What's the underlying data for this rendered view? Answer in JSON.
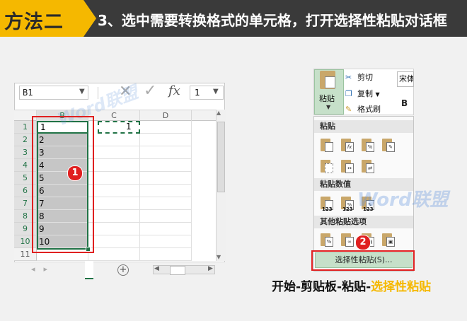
{
  "header": {
    "method": "方法二",
    "step": "3、选中需要转换格式的单元格，打开选择性粘贴对话框"
  },
  "formula_bar": {
    "name_box": "B1",
    "fx": "fx",
    "value": "1"
  },
  "sheet": {
    "columns": [
      "B",
      "C",
      "D"
    ],
    "rows": [
      "1",
      "2",
      "3",
      "4",
      "5",
      "6",
      "7",
      "8",
      "9",
      "10",
      "11"
    ],
    "b_values": [
      "1",
      "2",
      "3",
      "4",
      "5",
      "6",
      "7",
      "8",
      "9",
      "10"
    ],
    "c1_value": "1"
  },
  "badges": {
    "one": "1",
    "two": "2"
  },
  "ribbon": {
    "paste": "粘贴",
    "cut": "剪切",
    "copy": "复制",
    "format_painter": "格式刷",
    "font": "宋体",
    "bold": "B"
  },
  "paste_menu": {
    "section_paste": "粘贴",
    "section_values": "粘贴数值",
    "section_other": "其他粘贴选项",
    "paste_special": "选择性粘贴(S)...",
    "value_marks": [
      "123",
      "123",
      "123"
    ]
  },
  "watermark": "Word联盟",
  "path": {
    "prefix": "开始-剪贴板-粘贴-",
    "highlight": "选择性粘贴"
  },
  "colors": {
    "accent": "#f5b800",
    "excel_green": "#217346",
    "callout_red": "#e02020"
  }
}
